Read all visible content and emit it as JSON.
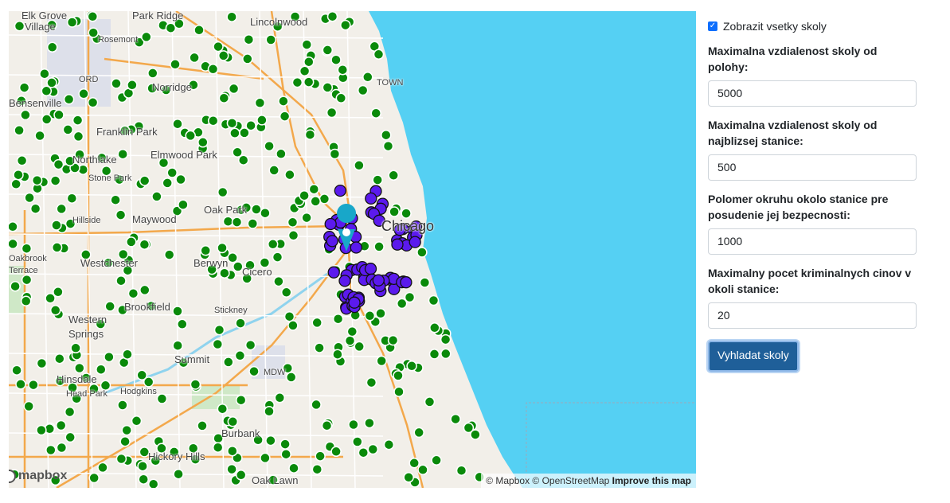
{
  "map": {
    "labels": [
      {
        "text": "Elk Grove",
        "cls": ""
      },
      {
        "text": "Village",
        "cls": ""
      },
      {
        "text": "Park Ridge",
        "cls": ""
      },
      {
        "text": "Lincolnwood",
        "cls": ""
      },
      {
        "text": "Rosemont",
        "cls": "small"
      },
      {
        "text": "ORD",
        "cls": "small"
      },
      {
        "text": "Norridge",
        "cls": ""
      },
      {
        "text": "Bensenville",
        "cls": ""
      },
      {
        "text": "Franklin Park",
        "cls": ""
      },
      {
        "text": "Elmwood Park",
        "cls": ""
      },
      {
        "text": "Northlake",
        "cls": ""
      },
      {
        "text": "Stone Park",
        "cls": "small"
      },
      {
        "text": "Hillside",
        "cls": "small"
      },
      {
        "text": "Maywood",
        "cls": ""
      },
      {
        "text": "Oak Park",
        "cls": ""
      },
      {
        "text": "Chicago",
        "cls": "city"
      },
      {
        "text": "Westchester",
        "cls": ""
      },
      {
        "text": "Berwyn",
        "cls": ""
      },
      {
        "text": "Cicero",
        "cls": ""
      },
      {
        "text": "Brookfield",
        "cls": ""
      },
      {
        "text": "Stickney",
        "cls": "small"
      },
      {
        "text": "Western",
        "cls": ""
      },
      {
        "text": "Springs",
        "cls": ""
      },
      {
        "text": "Summit",
        "cls": ""
      },
      {
        "text": "MDW",
        "cls": "small"
      },
      {
        "text": "Hinsdale",
        "cls": ""
      },
      {
        "text": "Head Park",
        "cls": "small"
      },
      {
        "text": "Hodgkins",
        "cls": "small"
      },
      {
        "text": "Burbank",
        "cls": ""
      },
      {
        "text": "Hickory Hills",
        "cls": ""
      },
      {
        "text": "Oak Lawn",
        "cls": ""
      },
      {
        "text": "Oakbrook",
        "cls": "small"
      },
      {
        "text": "Terrace",
        "cls": "small"
      },
      {
        "text": "TOWN",
        "cls": "small"
      }
    ],
    "logo": "mapbox",
    "attribution": "© Mapbox © OpenStreetMap",
    "improve": "Improve this map",
    "colors": {
      "school": "#0a8a0a",
      "selected": "#5b1aed",
      "marker": "#18a7c9",
      "water": "#55d0f3",
      "highway": "#f3a84b"
    }
  },
  "panel": {
    "show_all_label": "Zobrazit vsetky skoly",
    "show_all_checked": true,
    "fields": [
      {
        "label": "Maximalna vzdialenost skoly od polohy:",
        "value": "5000"
      },
      {
        "label": "Maximalna vzdialenost skoly od najblizsej stanice:",
        "value": "500"
      },
      {
        "label": "Polomer okruhu okolo stanice pre posudenie jej bezpecnosti:",
        "value": "1000"
      },
      {
        "label": "Maximalny pocet kriminalnych cinov v okoli stanice:",
        "value": "20"
      }
    ],
    "search_button": "Vyhladat skoly"
  }
}
